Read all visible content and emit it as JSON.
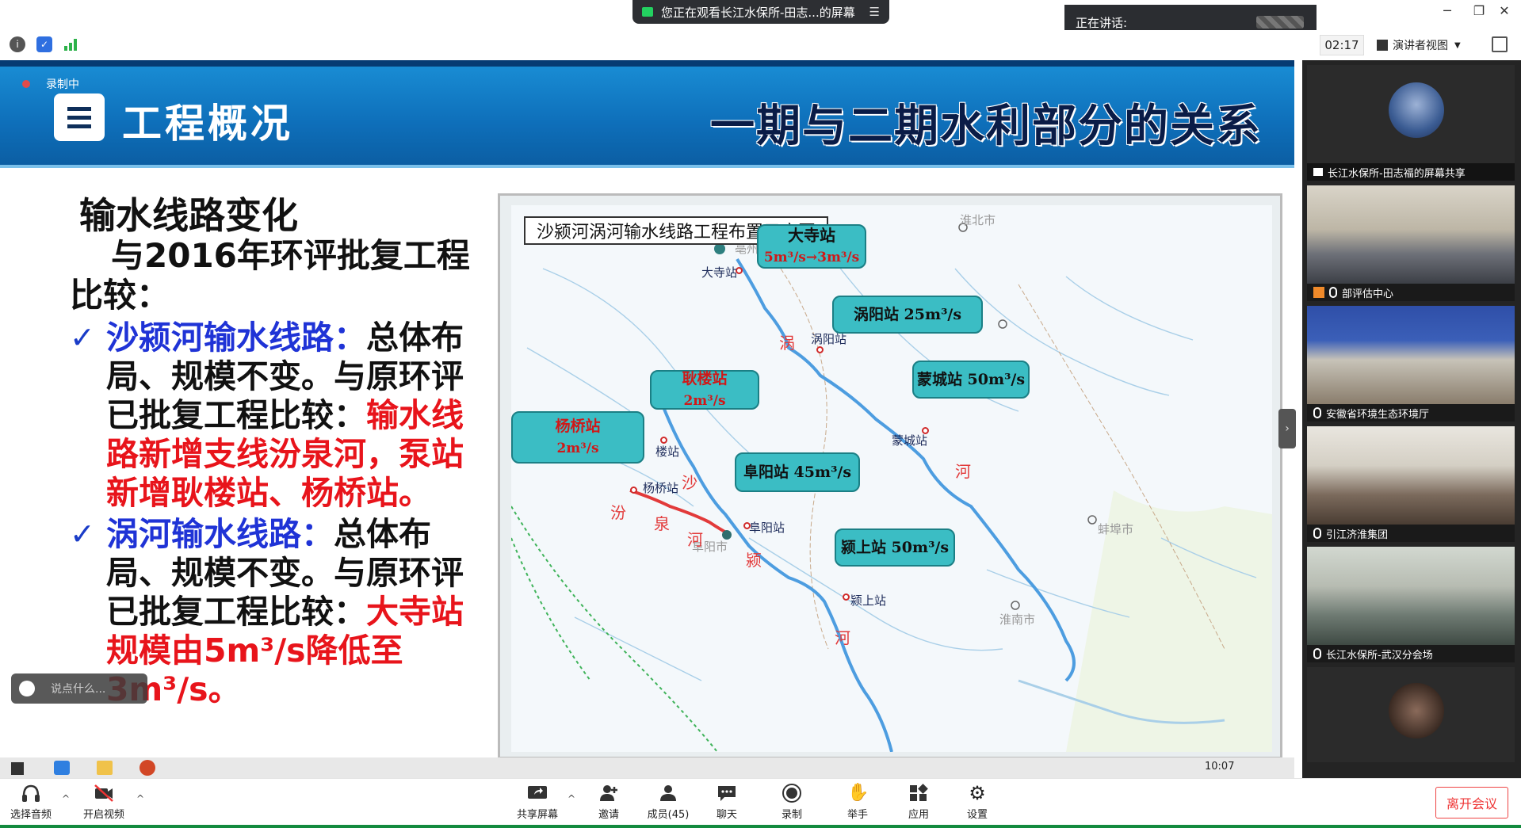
{
  "window": {
    "share_banner": "您正在观看长江水保所-田志...的屏幕",
    "speaking_label": "正在讲话:",
    "timer": "02:17",
    "view_mode": "演讲者视图"
  },
  "slide": {
    "recording": "录制中",
    "title": "工程概况",
    "right_title": "一期与二期水利部分的关系",
    "heading": "输水线路变化",
    "compare": "与2016年环评批复工程比较：",
    "bullet1": {
      "name": "沙颍河输水线路：",
      "black": "总体布局、规模不变。与原环评已批复工程比较：",
      "red": "输水线路新增支线汾泉河，泵站新增耿楼站、杨桥站。"
    },
    "bullet2": {
      "name": "涡河输水线路：",
      "black": "总体布局、规模不变。与原环评已批复工程比较：",
      "red": "大寺站规模由5m³/s降低至3m³/s。"
    },
    "chat_placeholder": "说点什么...",
    "taskbar_time": "10:07"
  },
  "map": {
    "caption": "沙颍河涡河输水线路工程布置示意图",
    "callouts": [
      {
        "id": "dasi",
        "line1": "大寺站",
        "line2": "5m³/s→3m³/s",
        "red": false
      },
      {
        "id": "guoyang",
        "line1": "涡阳站 25m³/s",
        "line2": "",
        "red": false
      },
      {
        "id": "mengcheng",
        "line1": "蒙城站 50m³/s",
        "line2": "",
        "red": false
      },
      {
        "id": "genglou",
        "line1": "耿楼站",
        "line2": "2m³/s",
        "red": true
      },
      {
        "id": "yangqiao",
        "line1": "杨桥站",
        "line2": "2m³/s",
        "red": true
      },
      {
        "id": "fuyang",
        "line1": "阜阳站 45m³/s",
        "line2": "",
        "red": false
      },
      {
        "id": "yingshang",
        "line1": "颍上站 50m³/s",
        "line2": "",
        "red": false
      }
    ],
    "stations": [
      "大寺站",
      "涡阳站",
      "蒙城站",
      "楼站",
      "杨桥站",
      "阜阳站",
      "颍上站"
    ],
    "places": [
      "亳州市",
      "淮北市",
      "蚌埠市",
      "淮南市",
      "阜阳市"
    ],
    "rivers": [
      "涡",
      "河",
      "沙",
      "颍",
      "河",
      "汾",
      "泉",
      "河"
    ]
  },
  "participants": [
    {
      "name": "长江水保所-田志福的屏幕共享",
      "kind": "avatar"
    },
    {
      "name": "部评估中心",
      "kind": "room"
    },
    {
      "name": "安徽省环境生态环境厅",
      "kind": "room"
    },
    {
      "name": "引江济淮集团",
      "kind": "room"
    },
    {
      "name": "长江水保所-武汉分会场",
      "kind": "room"
    }
  ],
  "toolbar": {
    "audio": "选择音频",
    "video": "开启视频",
    "share": "共享屏幕",
    "invite": "邀请",
    "members": "成员(45)",
    "chat": "聊天",
    "record": "录制",
    "hand": "举手",
    "apps": "应用",
    "settings": "设置",
    "leave": "离开会议"
  }
}
